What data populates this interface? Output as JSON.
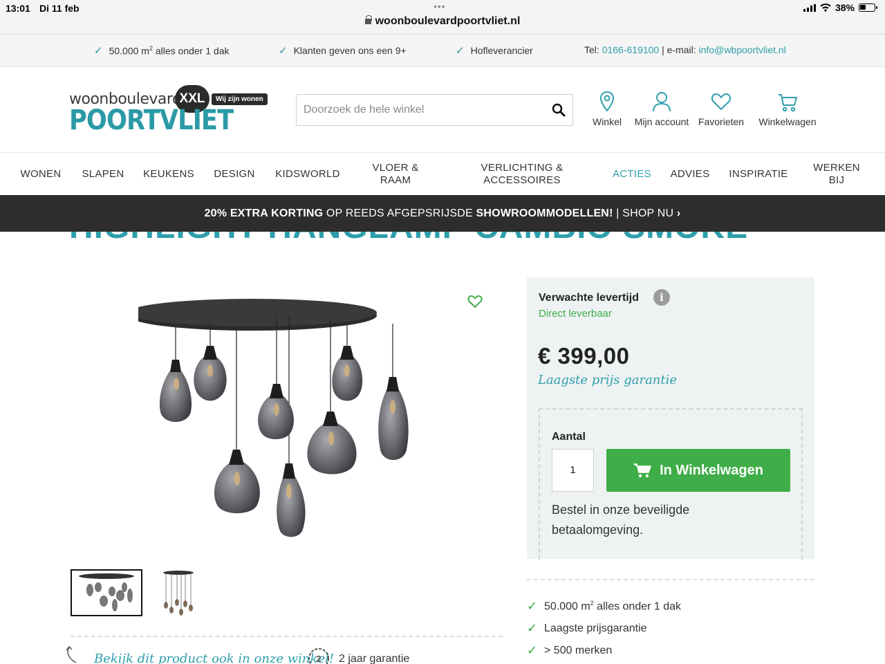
{
  "statusbar": {
    "time": "13:01",
    "date": "Di 11 feb",
    "battery": "38%",
    "url": "woonboulevardpoortvliet.nl"
  },
  "usp_bar": {
    "items": [
      "50.000 m",
      "Klanten geven ons een 9+",
      "Hofleverancier"
    ],
    "item1_sup": "2",
    "item1_rest": " alles onder 1 dak",
    "tel_label": "Tel: ",
    "tel": "0166-619100",
    "email_label": " | e-mail: ",
    "email": "info@wbpoortvliet.nl"
  },
  "logo": {
    "top": "woonboulevard",
    "badge": "XXL",
    "tagline": "Wij zijn wonen",
    "main": "POORTVLIET"
  },
  "search": {
    "placeholder": "Doorzoek de hele winkel"
  },
  "header_icons": [
    {
      "label": "Winkel",
      "icon": "location-pin-icon"
    },
    {
      "label": "Mijn account",
      "icon": "user-icon"
    },
    {
      "label": "Favorieten",
      "icon": "heart-icon"
    },
    {
      "label": "Winkelwagen",
      "icon": "cart-icon"
    }
  ],
  "nav": {
    "items": [
      "WONEN",
      "SLAPEN",
      "KEUKENS",
      "DESIGN",
      "KIDSWORLD",
      "VLOER &\nRAAM",
      "VERLICHTING &\nACCESSOIRES",
      "ACTIES",
      "ADVIES",
      "INSPIRATIE",
      "WERKEN\nBIJ"
    ],
    "active": "ACTIES"
  },
  "promo": {
    "bold1": "20% EXTRA KORTING",
    "text1": " OP REEDS AFGEPSRIJSDE ",
    "bold2": "SHOWROOMMODELLEN!",
    "text2": " | SHOP NU ",
    "chevron": "›"
  },
  "product": {
    "title": "HIGHLIGHT HANGLAMP CAMBIO SMOKE",
    "showroom_text": "Bekijk dit product ook in onze winkel!",
    "warranty": "2 jaar garantie",
    "warranty_icon_text": "2"
  },
  "buybox": {
    "delivery_label": "Verwachte levertijd",
    "info_icon": "i",
    "delivery_value": "Direct leverbaar",
    "price": "€ 399,00",
    "price_guarantee": "Laagste prijs garantie",
    "qty_label": "Aantal",
    "qty_value": "1",
    "add_to_cart": "In Winkelwagen",
    "secure_text": "Bestel in onze beveiligde betaalomgeving."
  },
  "right_usps": {
    "item1_main": "50.000 m",
    "item1_sup": "2",
    "item1_rest": " alles onder 1 dak",
    "item2": "Laagste prijsgarantie",
    "item3": "> 500 merken"
  },
  "colors": {
    "brand_teal": "#2e9fab",
    "cta_green": "#3fae48",
    "promo_bg": "#2d2d2d"
  }
}
